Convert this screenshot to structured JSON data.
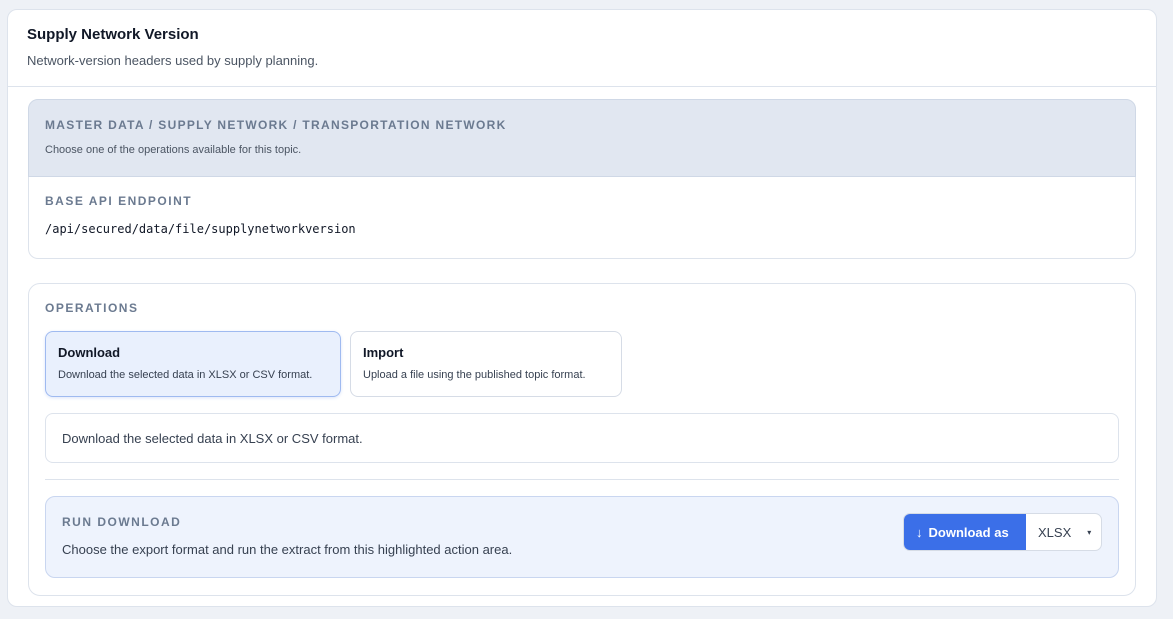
{
  "header": {
    "title": "Supply Network Version",
    "subtitle": "Network-version headers used by supply planning."
  },
  "topic": {
    "path": "MASTER DATA / SUPPLY NETWORK / TRANSPORTATION NETWORK",
    "hint": "Choose one of the operations available for this topic."
  },
  "endpoint": {
    "label": "BASE API ENDPOINT",
    "value": "/api/secured/data/file/supplynetworkversion"
  },
  "operations": {
    "label": "OPERATIONS",
    "items": [
      {
        "title": "Download",
        "description": "Download the selected data in XLSX or CSV format.",
        "selected": true
      },
      {
        "title": "Import",
        "description": "Upload a file using the published topic format.",
        "selected": false
      }
    ],
    "selected_description": "Download the selected data in XLSX or CSV format."
  },
  "run": {
    "label": "RUN DOWNLOAD",
    "description": "Choose the export format and run the extract from this highlighted action area.",
    "button_icon": "↓",
    "button_label": "Download as",
    "format_value": "XLSX",
    "caret_icon": "▾"
  },
  "colors": {
    "accent": "#3b6fe8",
    "selected_bg": "#e9f0fd",
    "topic_bg": "#e1e7f1"
  }
}
